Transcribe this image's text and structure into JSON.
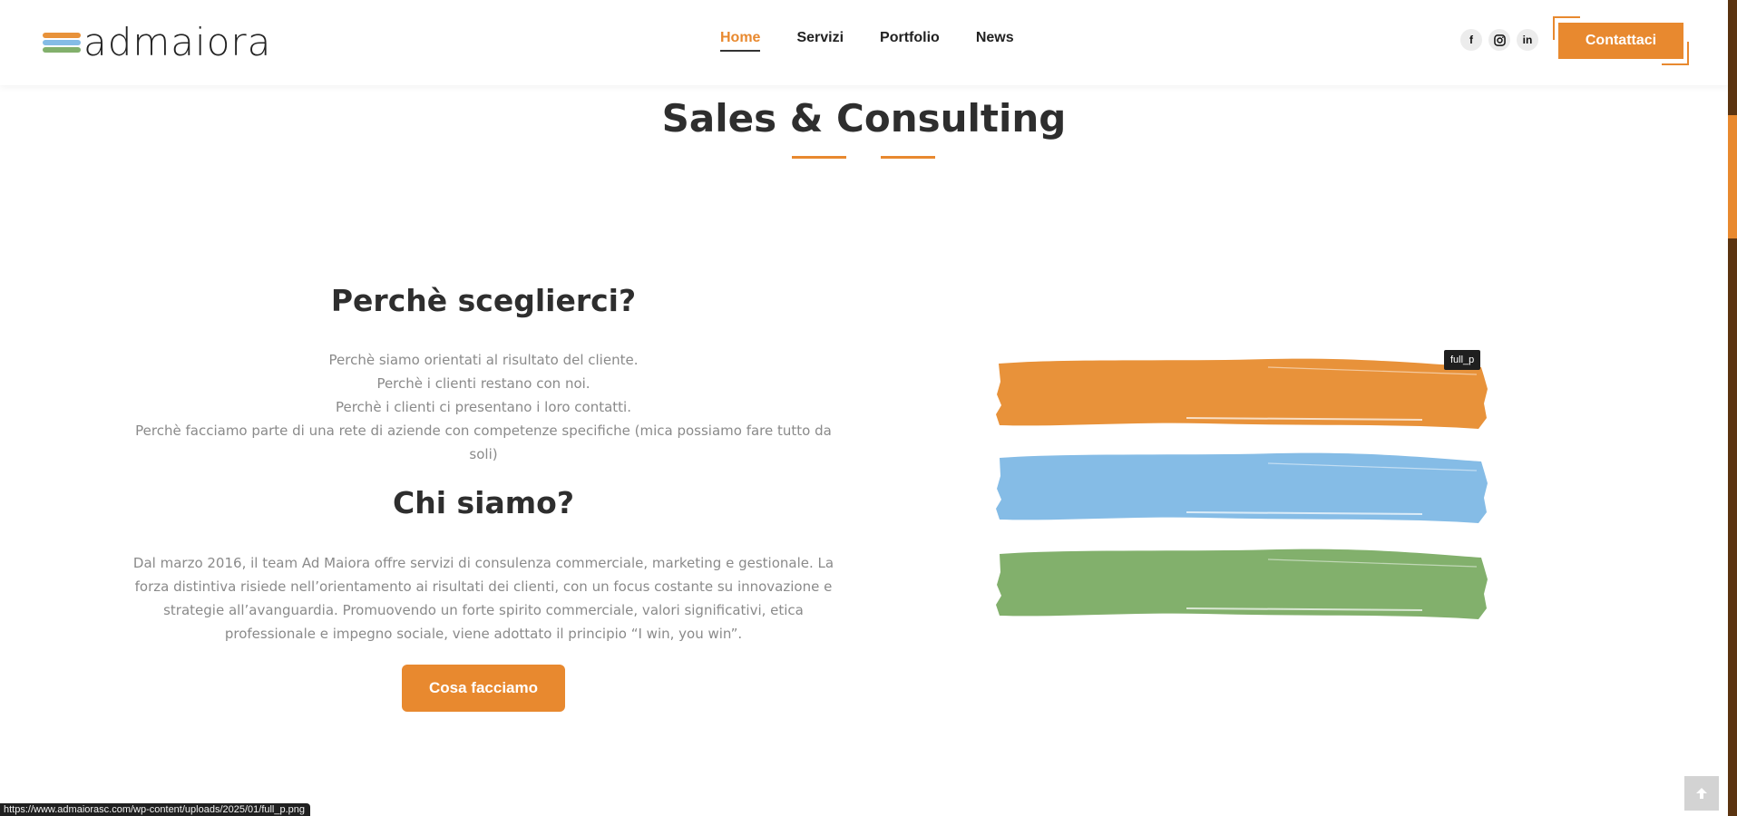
{
  "header": {
    "logo_text": "admaiora",
    "nav": [
      {
        "label": "Home",
        "active": true
      },
      {
        "label": "Servizi",
        "active": false
      },
      {
        "label": "Portfolio",
        "active": false
      },
      {
        "label": "News",
        "active": false
      }
    ],
    "socials": [
      {
        "icon": "facebook-icon",
        "glyph": "f"
      },
      {
        "icon": "instagram-icon",
        "glyph": "◎"
      },
      {
        "icon": "linkedin-icon",
        "glyph": "in"
      }
    ],
    "cta_label": "Contattaci"
  },
  "main": {
    "section_title": "Sales & Consulting",
    "why": {
      "heading": "Perchè sceglierci?",
      "lines": [
        "Perchè siamo orientati al risultato del cliente.",
        "Perchè i clienti restano con noi.",
        "Perchè i clienti ci presentano i loro contatti.",
        "Perchè facciamo parte di una rete di aziende con competenze specifiche (mica possiamo fare tutto da soli)"
      ]
    },
    "who": {
      "heading": "Chi siamo?",
      "text": "Dal marzo 2016, il team Ad Maiora offre servizi di consulenza commerciale, marketing e gestionale. La forza distintiva risiede nell’orientamento ai risultati dei clienti, con un focus costante su innovazione e strategie all’avanguardia. Promuovendo un forte spirito commerciale, valori significativi, etica professionale e impegno sociale, viene adottato il principio “I win, you win”."
    },
    "button_label": "Cosa facciamo",
    "image_tooltip": "full_p"
  },
  "colors": {
    "accent": "#e8892f",
    "stripe_orange": "#e8923a",
    "stripe_blue": "#85bce6",
    "stripe_green": "#82b06c",
    "text_dark": "#2e2e2e",
    "text_muted": "#8a8a8a"
  },
  "status_bar": "https://www.admaiorasc.com/wp-content/uploads/2025/01/full_p.png",
  "scroll_top_icon": "arrow-up-icon"
}
